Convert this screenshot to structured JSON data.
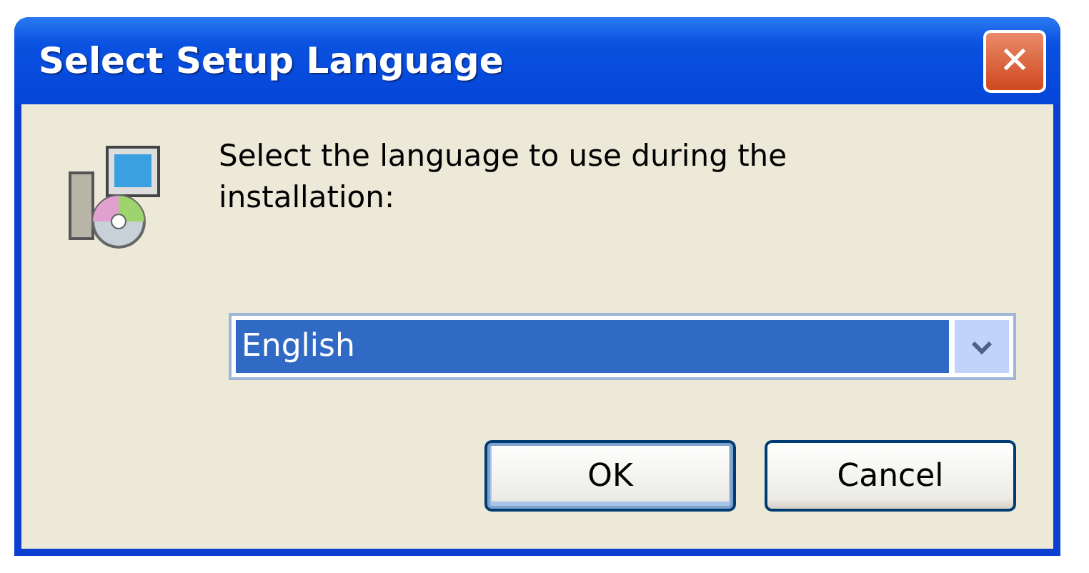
{
  "window": {
    "title": "Select Setup Language",
    "close": "✕"
  },
  "message": "Select the language to use during the installation:",
  "language_dropdown": {
    "value": "English",
    "highlighted": true
  },
  "buttons": [
    {
      "label": "OK",
      "default": true
    },
    {
      "label": "Cancel",
      "default": false
    }
  ]
}
